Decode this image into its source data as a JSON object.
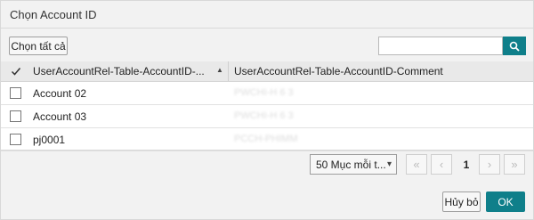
{
  "dialog": {
    "title": "Chọn Account ID"
  },
  "toolbar": {
    "select_all_label": "Chọn tất cả",
    "search_value": "",
    "search_icon": "search-icon"
  },
  "table": {
    "header": {
      "col1": "UserAccountRel-Table-AccountID-...",
      "sort_indicator": "▲",
      "col2": "UserAccountRel-Table-AccountID-Comment"
    },
    "rows": [
      {
        "account": "Account 02",
        "comment": "PWCHI-H 6 3"
      },
      {
        "account": "Account 03",
        "comment": "PWCHI-H 6 3"
      },
      {
        "account": "pj0001",
        "comment": "PCCH-PHIMM"
      }
    ]
  },
  "pagination": {
    "per_page": "50 Mục mỗi t...",
    "first": "«",
    "prev": "‹",
    "current_page": "1",
    "next": "›",
    "last": "»"
  },
  "footer": {
    "cancel_label": "Hủy bỏ",
    "ok_label": "OK"
  },
  "colors": {
    "accent": "#0f7f8a"
  }
}
